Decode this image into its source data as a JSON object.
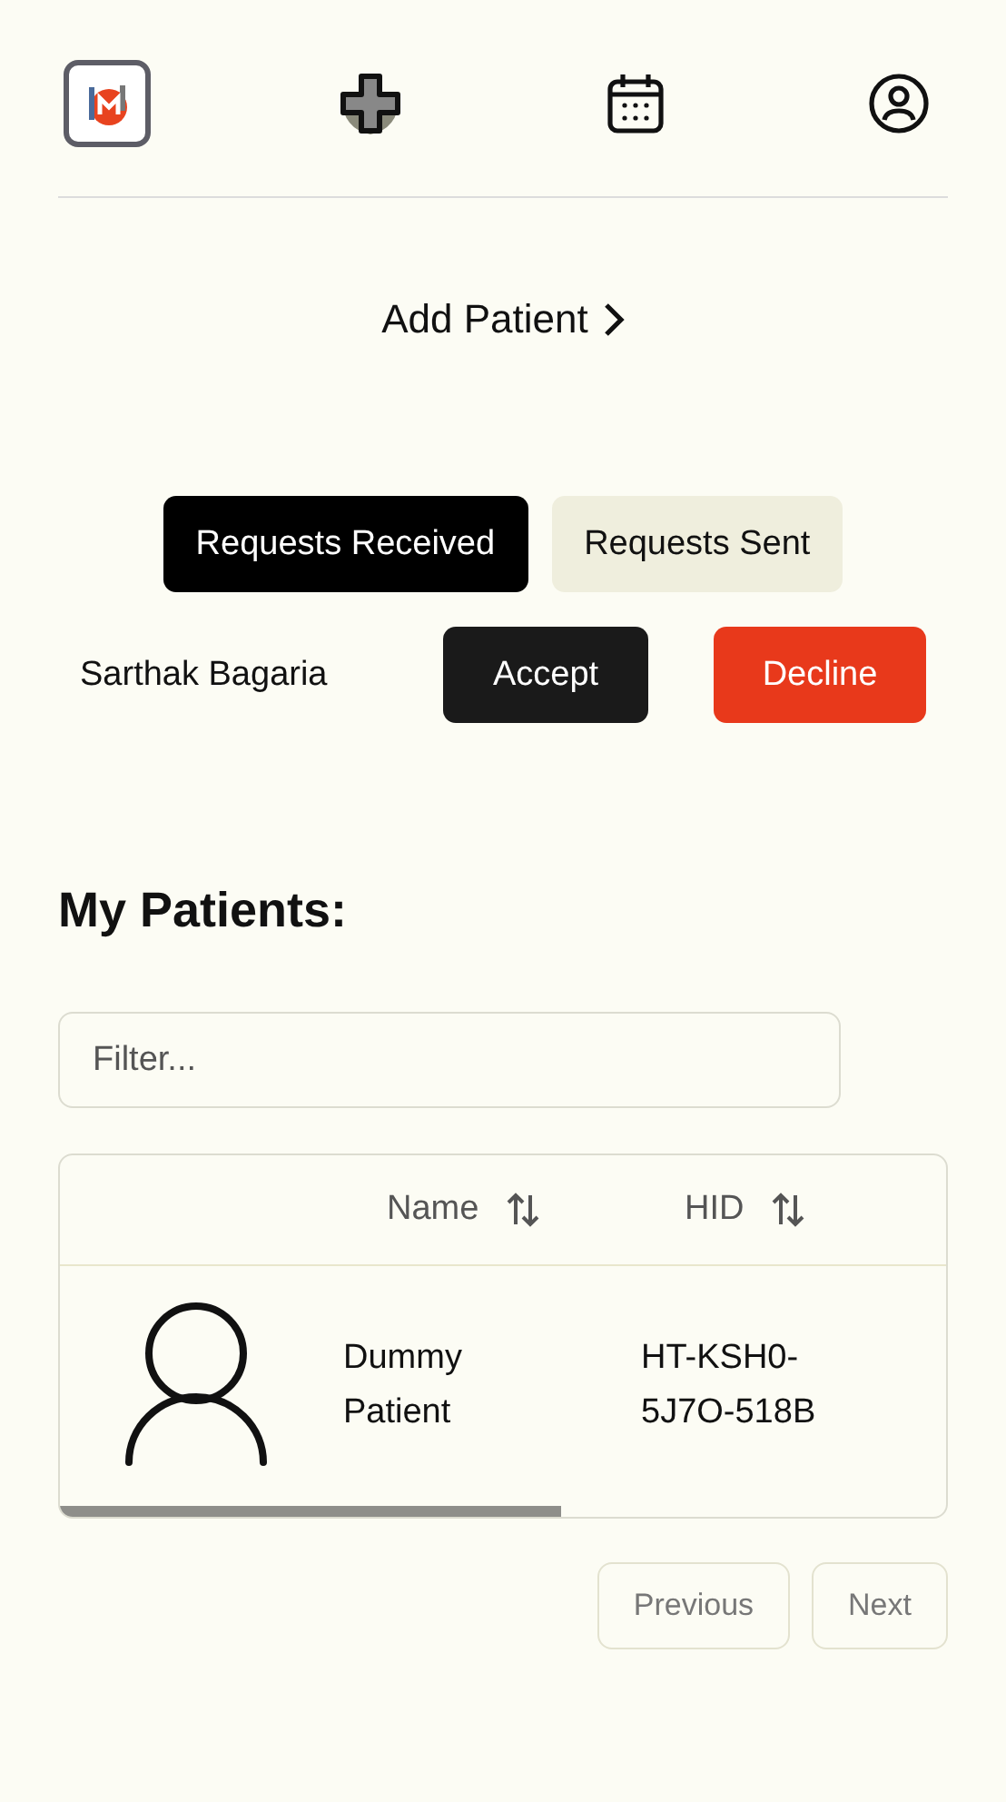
{
  "nav": {
    "items": [
      {
        "kind": "logo"
      },
      {
        "kind": "plus"
      },
      {
        "kind": "calendar"
      },
      {
        "kind": "profile"
      }
    ]
  },
  "add_patient": {
    "label": "Add Patient"
  },
  "tabs": [
    {
      "label": "Requests Received",
      "selected": true
    },
    {
      "label": "Requests Sent",
      "selected": false
    }
  ],
  "requests": [
    {
      "name": "Sarthak Bagaria",
      "accept": "Accept",
      "decline": "Decline"
    }
  ],
  "patients": {
    "title": "My Patients:",
    "filter": {
      "placeholder": "Filter..."
    },
    "columns": [
      "Name",
      "HID"
    ],
    "rows": [
      {
        "name": "Dummy Patient",
        "hid": "HT-KSH0-5J7O-518B"
      }
    ]
  },
  "pagination": {
    "previous": "Previous",
    "next": "Next"
  }
}
